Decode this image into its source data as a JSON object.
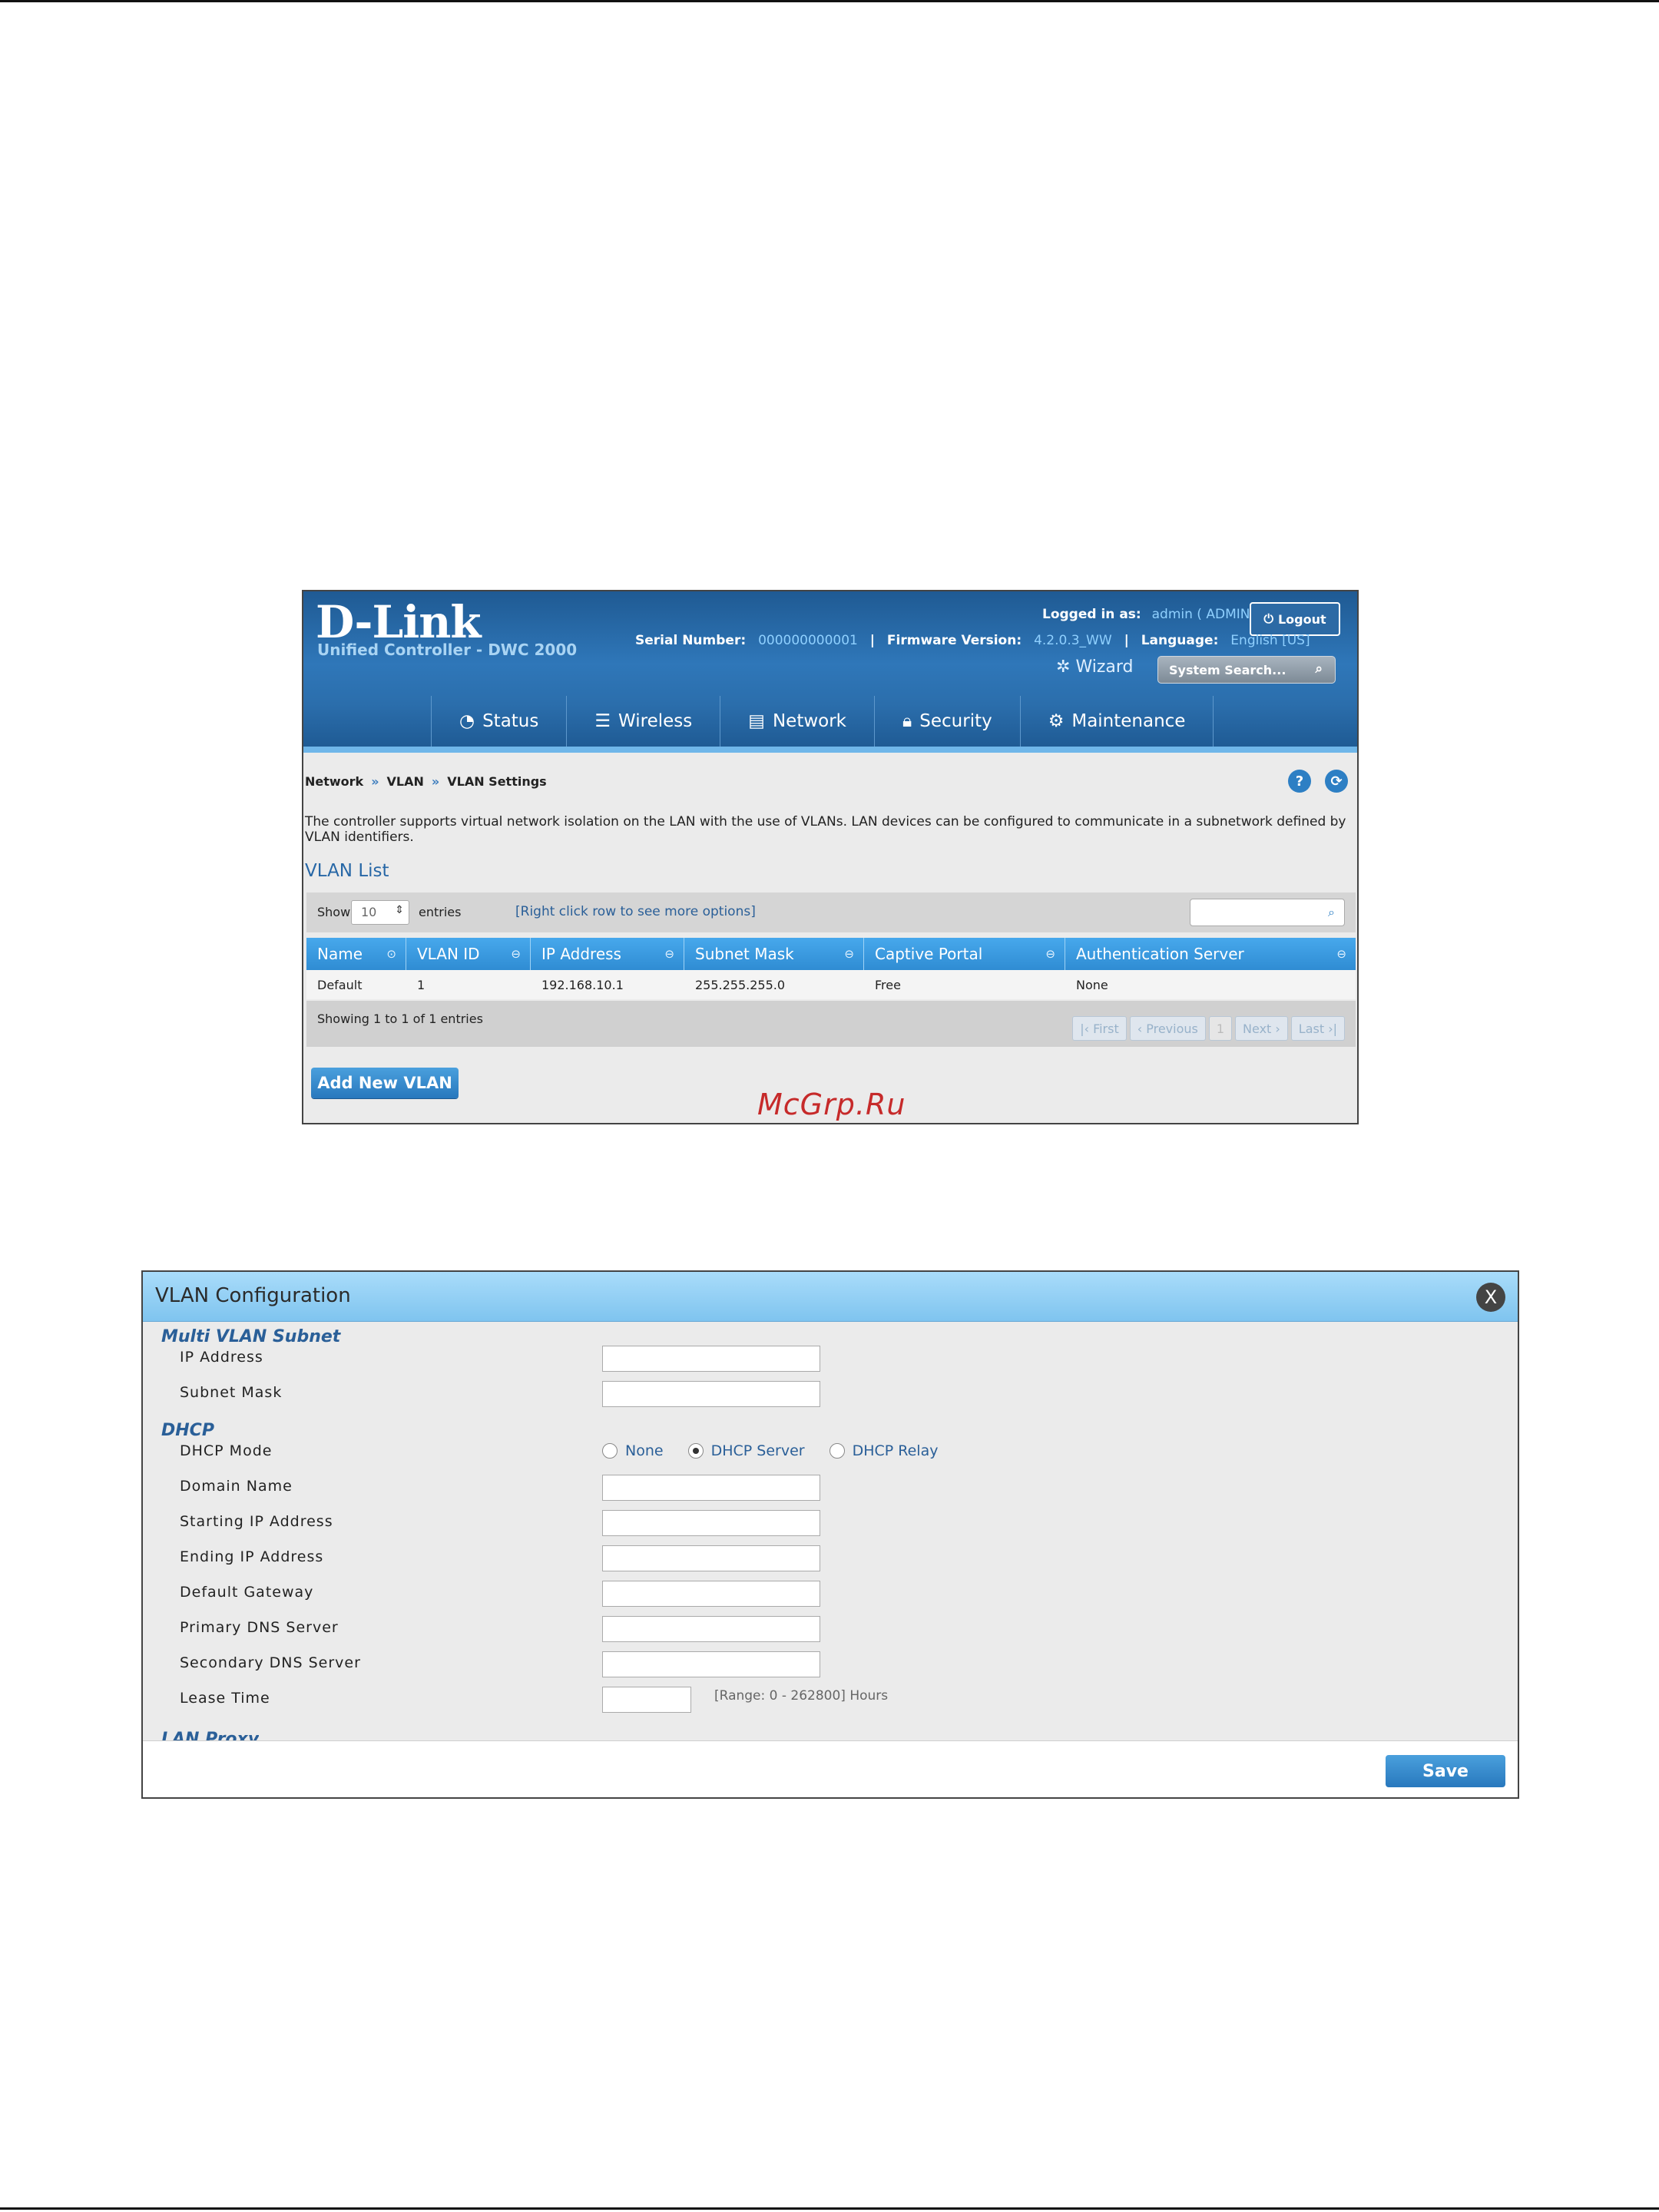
{
  "controller": {
    "brand": "D-Link",
    "subtitle": "Unified Controller - DWC 2000",
    "logged_in_label": "Logged in as:",
    "logged_in_value": "admin ( ADMIN )",
    "logout_label": "Logout",
    "serial_label": "Serial Number:",
    "serial_value": "000000000001",
    "firmware_label": "Firmware Version:",
    "firmware_value": "4.2.0.3_WW",
    "language_label": "Language:",
    "language_value": "English [US]",
    "wizard_label": "Wizard",
    "system_search_placeholder": "System Search...",
    "nav": [
      {
        "label": "Status",
        "icon": "gauge-icon"
      },
      {
        "label": "Wireless",
        "icon": "wifi-icon"
      },
      {
        "label": "Network",
        "icon": "network-icon"
      },
      {
        "label": "Security",
        "icon": "lock-icon"
      },
      {
        "label": "Maintenance",
        "icon": "gear-icon"
      }
    ],
    "breadcrumb": [
      "Network",
      "VLAN",
      "VLAN Settings"
    ],
    "description": "The controller supports virtual network isolation on the LAN with the use of VLANs. LAN devices can be configured to communicate in a subnetwork defined by VLAN identifiers.",
    "list_title": "VLAN List",
    "show_label": "Show",
    "entries_value": "10",
    "entries_label": "entries",
    "hint": "[Right click row to see more options]",
    "columns": [
      "Name",
      "VLAN ID",
      "IP Address",
      "Subnet Mask",
      "Captive Portal",
      "Authentication Server"
    ],
    "rows": [
      [
        "Default",
        "1",
        "192.168.10.1",
        "255.255.255.0",
        "Free",
        "None"
      ]
    ],
    "showing": "Showing 1 to 1 of 1 entries",
    "pager": {
      "first": "First",
      "previous": "Previous",
      "page": "1",
      "next": "Next",
      "last": "Last"
    },
    "add_button": "Add New VLAN"
  },
  "watermark": "McGrp.Ru",
  "dialog": {
    "title": "VLAN Configuration",
    "close": "X",
    "section_multi": "Multi VLAN Subnet",
    "ip_address": "IP Address",
    "subnet_mask": "Subnet Mask",
    "section_dhcp": "DHCP",
    "dhcp_mode": "DHCP Mode",
    "dhcp_options": [
      "None",
      "DHCP Server",
      "DHCP Relay"
    ],
    "dhcp_selected": "DHCP Server",
    "domain_name": "Domain Name",
    "starting_ip": "Starting IP Address",
    "ending_ip": "Ending IP Address",
    "default_gateway": "Default Gateway",
    "primary_dns": "Primary DNS Server",
    "secondary_dns": "Secondary DNS Server",
    "lease_time": "Lease Time",
    "lease_range": "[Range: 0 - 262800] Hours",
    "section_lan_proxy": "LAN Proxy",
    "save": "Save"
  }
}
